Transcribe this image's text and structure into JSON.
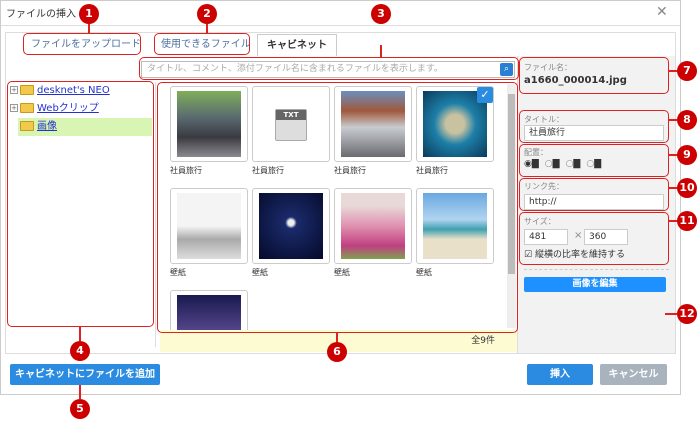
{
  "dialog": {
    "title": "ファイルの挿入",
    "close_icon": "close-icon"
  },
  "tabs": [
    {
      "label": "ファイルをアップロード"
    },
    {
      "label": "使用できるファイル"
    },
    {
      "label": "キャビネット",
      "active": true
    }
  ],
  "search": {
    "placeholder": "タイトル、コメント、添付ファイル名に含まれるファイルを表示します。"
  },
  "tree": [
    {
      "label": "desknet's NEO",
      "expandable": true
    },
    {
      "label": "Webクリップ",
      "expandable": true
    },
    {
      "label": "画像",
      "selected": true
    }
  ],
  "files": [
    {
      "caption": "社員旅行",
      "kind": "photo-alley"
    },
    {
      "caption": "社員旅行",
      "kind": "txt"
    },
    {
      "caption": "社員旅行",
      "kind": "photo-tanks"
    },
    {
      "caption": "社員旅行",
      "kind": "photo-sea",
      "selected": true
    },
    {
      "caption": "壁紙",
      "kind": "photo-people"
    },
    {
      "caption": "壁紙",
      "kind": "photo-moon"
    },
    {
      "caption": "壁紙",
      "kind": "photo-flowers"
    },
    {
      "caption": "壁紙",
      "kind": "photo-beach"
    },
    {
      "caption": "",
      "kind": "photo-night"
    }
  ],
  "txt_label": "TXT",
  "footer": {
    "count": "全9件"
  },
  "details": {
    "filename_label": "ファイル名：",
    "filename": "a1660_000014.jpg",
    "title_label": "タイトル：",
    "title_value": "社員旅行",
    "align_label": "配置：",
    "align_selected": 0,
    "link_label": "リンク先：",
    "link_value": "http://",
    "size_label": "サイズ：",
    "width": "481",
    "times": "×",
    "height": "360",
    "keep_ratio_label": "縦横の比率を維持する",
    "keep_ratio": true,
    "edit_button": "画像を編集"
  },
  "buttons": {
    "add": "キャビネットにファイルを追加",
    "insert": "挿入",
    "cancel": "キャンセル"
  },
  "colors": {
    "accent": "#1e90ff",
    "badge": "#cc0000",
    "selected_tree": "#d9f5b3"
  },
  "badges": [
    "1",
    "2",
    "3",
    "4",
    "5",
    "6",
    "7",
    "8",
    "9",
    "10",
    "11",
    "12"
  ]
}
